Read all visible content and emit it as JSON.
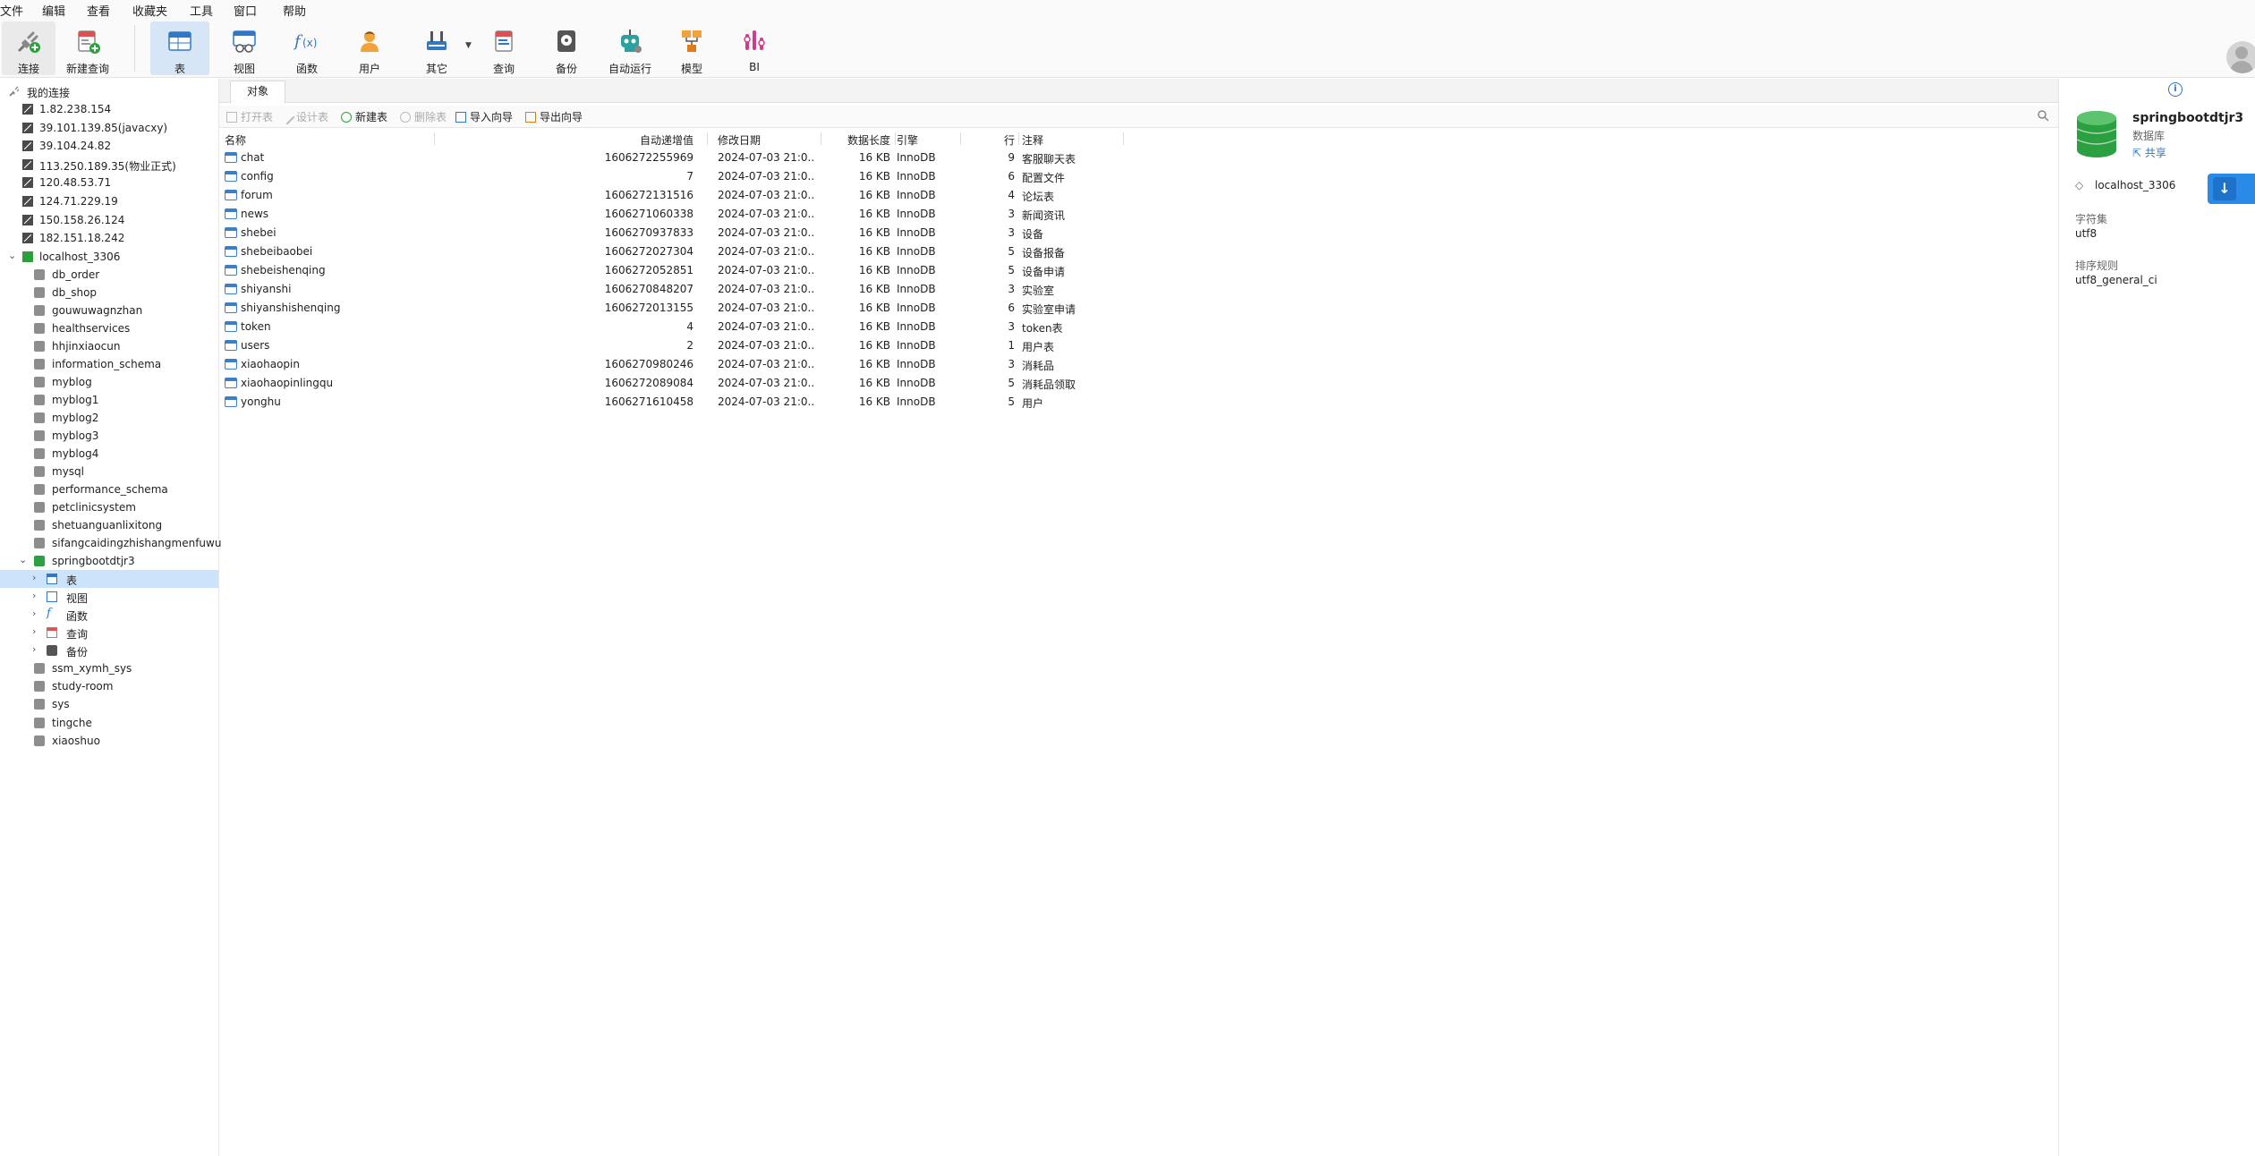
{
  "menu": [
    "文件",
    "编辑",
    "查看",
    "收藏夹",
    "工具",
    "窗口",
    "帮助"
  ],
  "toolbar": {
    "connect": "连接",
    "new_query": "新建查询",
    "table": "表",
    "view": "视图",
    "function": "函数",
    "user": "用户",
    "other": "其它",
    "query": "查询",
    "backup": "备份",
    "automation": "自动运行",
    "model": "模型",
    "bi": "BI"
  },
  "sidebar": {
    "root": "我的连接",
    "connections": [
      "1.82.238.154",
      "39.101.139.85(javacxy)",
      "39.104.24.82",
      "113.250.189.35(物业正式)",
      "120.48.53.71",
      "124.71.229.19",
      "150.158.26.124",
      "182.151.18.242"
    ],
    "active_connection": "localhost_3306",
    "databases_before": [
      "db_order",
      "db_shop",
      "gouwuwagnzhan",
      "healthservices",
      "hhjinxiaocun",
      "information_schema",
      "myblog",
      "myblog1",
      "myblog2",
      "myblog3",
      "myblog4",
      "mysql",
      "performance_schema",
      "petclinicsystem",
      "shetuanguanlixitong",
      "sifangcaidingzhishangmenfuwu"
    ],
    "open_database": "springbootdtjr3",
    "children": [
      "表",
      "视图",
      "函数",
      "查询",
      "备份"
    ],
    "databases_after": [
      "ssm_xymh_sys",
      "study-room",
      "sys",
      "tingche",
      "xiaoshuo"
    ]
  },
  "tab": {
    "objects": "对象"
  },
  "objbar": {
    "open_table": "打开表",
    "design_table": "设计表",
    "new_table": "新建表",
    "delete_table": "删除表",
    "import_wizard": "导入向导",
    "export_wizard": "导出向导"
  },
  "grid": {
    "columns": [
      "名称",
      "自动递增值",
      "修改日期",
      "数据长度",
      "引擎",
      "行",
      "注释"
    ],
    "rows": [
      [
        "chat",
        "1606272255969",
        "2024-07-03 21:0...",
        "16 KB",
        "InnoDB",
        "9",
        "客服聊天表"
      ],
      [
        "config",
        "7",
        "2024-07-03 21:0...",
        "16 KB",
        "InnoDB",
        "6",
        "配置文件"
      ],
      [
        "forum",
        "1606272131516",
        "2024-07-03 21:0...",
        "16 KB",
        "InnoDB",
        "4",
        "论坛表"
      ],
      [
        "news",
        "1606271060338",
        "2024-07-03 21:0...",
        "16 KB",
        "InnoDB",
        "3",
        "新闻资讯"
      ],
      [
        "shebei",
        "1606270937833",
        "2024-07-03 21:0...",
        "16 KB",
        "InnoDB",
        "3",
        "设备"
      ],
      [
        "shebeibaobei",
        "1606272027304",
        "2024-07-03 21:0...",
        "16 KB",
        "InnoDB",
        "5",
        "设备报备"
      ],
      [
        "shebeishenqing",
        "1606272052851",
        "2024-07-03 21:0...",
        "16 KB",
        "InnoDB",
        "5",
        "设备申请"
      ],
      [
        "shiyanshi",
        "1606270848207",
        "2024-07-03 21:0...",
        "16 KB",
        "InnoDB",
        "3",
        "实验室"
      ],
      [
        "shiyanshishenqing",
        "1606272013155",
        "2024-07-03 21:0...",
        "16 KB",
        "InnoDB",
        "6",
        "实验室申请"
      ],
      [
        "token",
        "4",
        "2024-07-03 21:0...",
        "16 KB",
        "InnoDB",
        "3",
        "token表"
      ],
      [
        "users",
        "2",
        "2024-07-03 21:0...",
        "16 KB",
        "InnoDB",
        "1",
        "用户表"
      ],
      [
        "xiaohaopin",
        "1606270980246",
        "2024-07-03 21:0...",
        "16 KB",
        "InnoDB",
        "3",
        "消耗品"
      ],
      [
        "xiaohaopinlingqu",
        "1606272089084",
        "2024-07-03 21:0...",
        "16 KB",
        "InnoDB",
        "5",
        "消耗品领取"
      ],
      [
        "yonghu",
        "1606271610458",
        "2024-07-03 21:0...",
        "16 KB",
        "InnoDB",
        "5",
        "用户"
      ]
    ]
  },
  "right_panel": {
    "db_name": "springbootdtjr3",
    "db_type": "数据库",
    "share": "共享",
    "connection": "localhost_3306",
    "charset_label": "字符集",
    "charset": "utf8",
    "collation_label": "排序规则",
    "collation": "utf8_general_ci"
  }
}
